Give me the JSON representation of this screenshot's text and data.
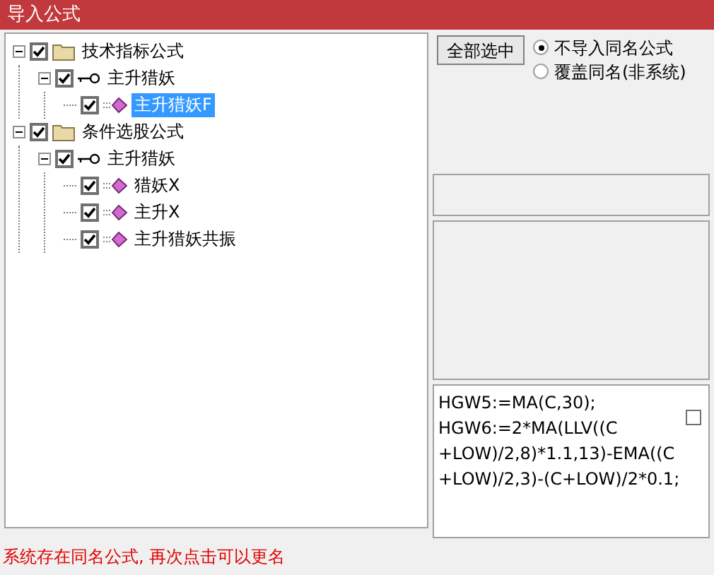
{
  "window": {
    "title": "导入公式"
  },
  "tree": [
    {
      "label": "技术指标公式",
      "kind": "folder",
      "checked": true,
      "expanded": true,
      "selected": false,
      "children": [
        {
          "label": "主升猎妖",
          "kind": "key",
          "checked": true,
          "expanded": true,
          "selected": false,
          "children": [
            {
              "label": "主升猎妖F",
              "kind": "formula",
              "checked": true,
              "selected": true
            }
          ]
        }
      ]
    },
    {
      "label": "条件选股公式",
      "kind": "folder",
      "checked": true,
      "expanded": true,
      "selected": false,
      "children": [
        {
          "label": "主升猎妖",
          "kind": "key",
          "checked": true,
          "expanded": true,
          "selected": false,
          "children": [
            {
              "label": "猎妖X",
              "kind": "formula",
              "checked": true,
              "selected": false
            },
            {
              "label": "主升X",
              "kind": "formula",
              "checked": true,
              "selected": false
            },
            {
              "label": "主升猎妖共振",
              "kind": "formula",
              "checked": true,
              "selected": false
            }
          ]
        }
      ]
    }
  ],
  "select_all_button": "全部选中",
  "options": [
    {
      "label": "不导入同名公式",
      "selected": true
    },
    {
      "label": "覆盖同名(非系统)",
      "selected": false
    }
  ],
  "formula_text": [
    "HGW5:=MA(C,30);",
    "HGW6:=2*MA(LLV((C",
    "+LOW)/2,8)*1.1,13)-EMA((C",
    "+LOW)/2,3)-(C+LOW)/2*0.1;"
  ],
  "formula_checkbox": {
    "checked": false
  },
  "status_bar": "系统存在同名公式, 再次点击可以更名"
}
